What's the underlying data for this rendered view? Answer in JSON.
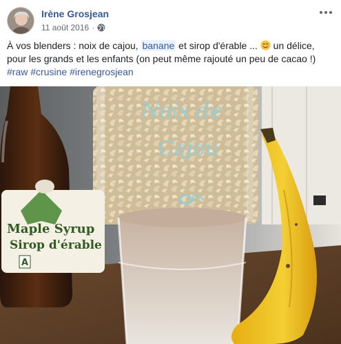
{
  "post": {
    "author": "Irène Grosjean",
    "date": "11 août 2016",
    "separator": "·",
    "text": {
      "line1_before": "À vos blenders : noix de cajou, ",
      "highlight": "banane",
      "line1_after": " et sirop d'érable ... ",
      "line1_end": " un délice,",
      "line2": "pour les grands et les enfants (on peut même rajouté un peu de cacao !)",
      "hashtags": [
        "#raw",
        "#crusine",
        "#irenegrosjean"
      ]
    },
    "emoji": "smiling-face-emoji"
  },
  "photo": {
    "jar_writing_1": "Noix de",
    "jar_writing_2": "Cajou",
    "bottle_label_1": "Maple Syrup",
    "bottle_label_2": "Sirop d'érable",
    "bottle_badge": "A"
  },
  "colors": {
    "link": "#385898",
    "meta": "#616770",
    "text": "#1c1e21"
  },
  "icons": {
    "privacy": "globe-icon",
    "options": "more-options-icon"
  }
}
